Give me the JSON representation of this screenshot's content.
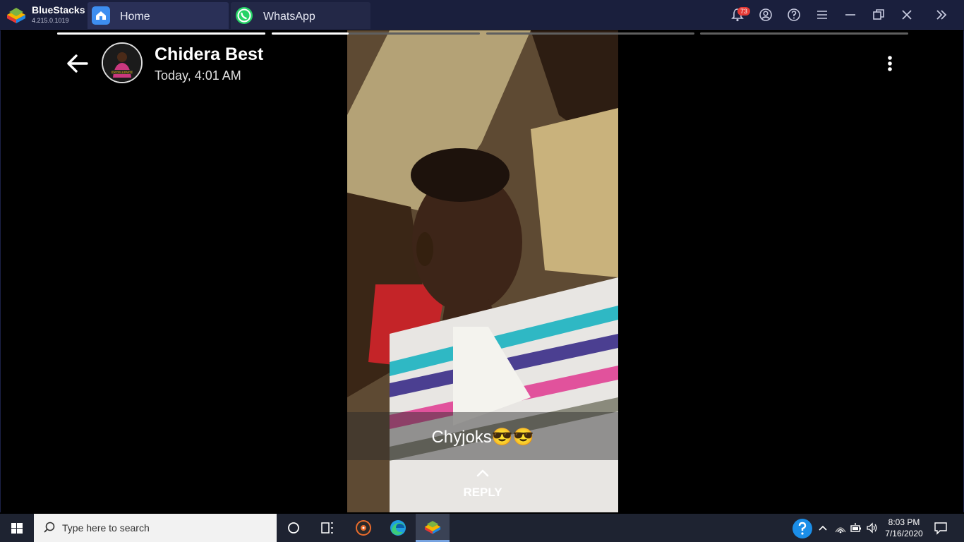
{
  "bluestacks": {
    "name": "BlueStacks",
    "version": "4.215.0.1019",
    "tabs": [
      {
        "label": "Home"
      },
      {
        "label": "WhatsApp"
      }
    ],
    "notification_count": "73"
  },
  "status_view": {
    "contact_name": "Chidera Best",
    "timestamp": "Today, 4:01 AM",
    "avatar_text": "EXCELLENCE",
    "caption": "Chyjoks😎😎",
    "reply_label": "REPLY",
    "progress": [
      1.0,
      0.37,
      0.0,
      0.0
    ]
  },
  "taskbar": {
    "search_placeholder": "Type here to search",
    "time": "8:03 PM",
    "date": "7/16/2020"
  },
  "colors": {
    "titlebar": "#1a1f3d",
    "taskbar": "#1e2331",
    "whatsapp_green": "#25d366",
    "badge_red": "#e53935"
  }
}
